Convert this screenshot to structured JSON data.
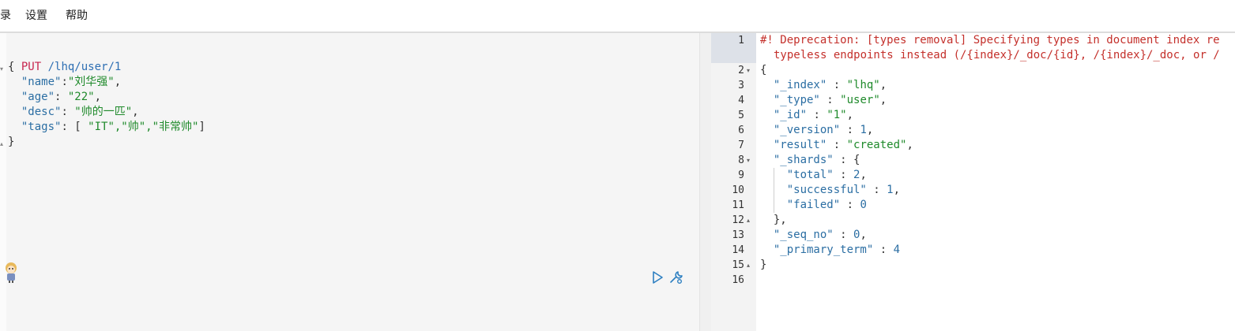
{
  "menu": {
    "items": [
      {
        "label": "录"
      },
      {
        "label": "设置"
      },
      {
        "label": "帮助"
      }
    ]
  },
  "request": {
    "method": "PUT",
    "path": "/lhq/user/1",
    "open_brace": "{",
    "close_brace": "}",
    "fields": [
      {
        "key": "\"name\"",
        "sep": ":",
        "value": "\"刘华强\"",
        "tail": ","
      },
      {
        "key": "\"age\"",
        "sep": ": ",
        "value": "\"22\"",
        "tail": ","
      },
      {
        "key": "\"desc\"",
        "sep": ": ",
        "value": "\"帅的一匹\"",
        "tail": ","
      },
      {
        "key": "\"tags\"",
        "sep": ": [ ",
        "value": "\"IT\",\"帅\",\"非常帅\"",
        "tail": "]"
      }
    ]
  },
  "actions": {
    "send_icon": "play-icon",
    "settings_icon": "wrench-icon"
  },
  "response": {
    "line_numbers": [
      "1",
      "",
      "2",
      "3",
      "4",
      "5",
      "6",
      "7",
      "8",
      "9",
      "10",
      "11",
      "12",
      "13",
      "14",
      "15",
      "16"
    ],
    "warning_line1": "#! Deprecation: [types removal] Specifying types in document index re",
    "warning_line2": "typeless endpoints instead (/{index}/_doc/{id}, /{index}/_doc, or /",
    "lines": [
      {
        "key": "\"_index\"",
        "value": "\"lhq\"",
        "tail": ","
      },
      {
        "key": "\"_type\"",
        "value": "\"user\"",
        "tail": ","
      },
      {
        "key": "\"_id\"",
        "value": "\"1\"",
        "tail": ","
      },
      {
        "key": "\"_version\"",
        "value": "1",
        "tail": ","
      },
      {
        "key": "\"result\"",
        "value": "\"created\"",
        "tail": ","
      },
      {
        "key": "\"_shards\"",
        "value": "{",
        "tail": ""
      },
      {
        "key": "\"total\"",
        "value": "2",
        "tail": ","
      },
      {
        "key": "\"successful\"",
        "value": "1",
        "tail": ","
      },
      {
        "key": "\"failed\"",
        "value": "0",
        "tail": ""
      },
      {
        "key": "",
        "value": "},",
        "tail": ""
      },
      {
        "key": "\"_seq_no\"",
        "value": "0",
        "tail": ","
      },
      {
        "key": "\"_primary_term\"",
        "value": "4",
        "tail": ""
      }
    ],
    "open_brace": "{",
    "close_brace": "}",
    "colon": " : "
  },
  "colors": {
    "method": "#c7254e",
    "key": "#2b6ea3",
    "string": "#1f8a2b",
    "warning": "#c4302b"
  }
}
